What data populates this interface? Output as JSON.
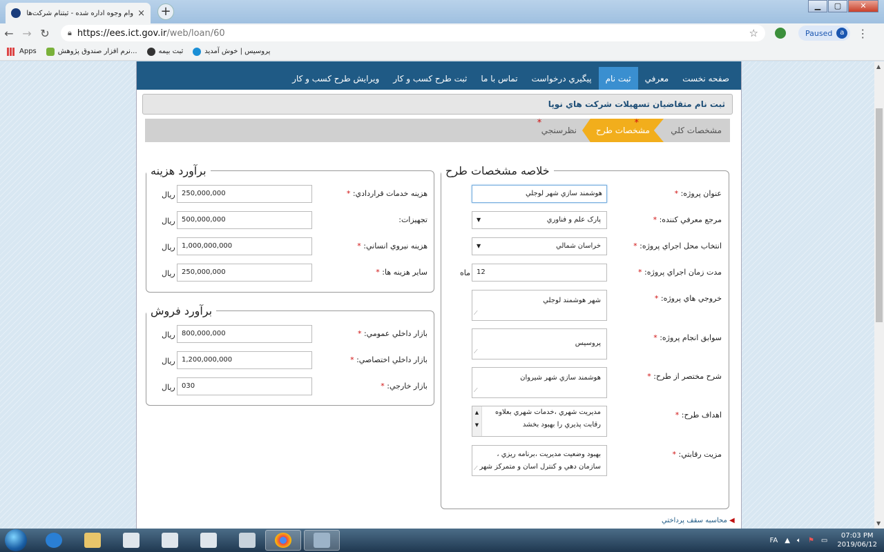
{
  "browser": {
    "tab_title": "وام وجوه اداره شده - ثبتنام شرکت‌های نوپا",
    "tab_close": "×",
    "new_tab": "+",
    "url_host": "https://ees.ict.gov.ir",
    "url_path": "/web/loan/60",
    "profile_status": "Paused",
    "profile_initial": "a",
    "bookmarks": [
      {
        "label": "Apps",
        "color": "#d44"
      },
      {
        "label": "نرم افزار صندوق پژوهش...",
        "color": "#7ab13a"
      },
      {
        "label": "ثبت بیمه",
        "color": "#333"
      },
      {
        "label": "پروسیس | خوش آمدید",
        "color": "#1a8fd6"
      }
    ]
  },
  "nav": {
    "items": [
      "صفحه نخست",
      "معرفي",
      "ثبت نام",
      "پيگيري درخواست",
      "تماس با ما",
      "ثبت طرح کسب و کار",
      "ويرايش طرح کسب و کار"
    ],
    "active_index": 2
  },
  "header": {
    "title": "ثبت نام متقاضيان تسهيلات شرکت هاي نوپا"
  },
  "steps": [
    {
      "label": "مشخصات کلي",
      "required": false
    },
    {
      "label": "مشخصات طرح",
      "required": true
    },
    {
      "label": "نظرسنجي",
      "required": true
    }
  ],
  "summary": {
    "legend": "خلاصه مشخصات طرح",
    "fields": {
      "title_label": "عنوان پروژه:",
      "title_value": "هوشمند سازي شهر لوجلي",
      "referrer_label": "مرجع معرفي کننده:",
      "referrer_value": "پارک علم و فناوري",
      "location_label": "انتخاب محل اجراي پروژه:",
      "location_value": "خراسان شمالي",
      "duration_label": "مدت زمان اجراي پروژه:",
      "duration_value": "12",
      "duration_unit": "ماه",
      "outputs_label": "خروجي هاي پروژه:",
      "outputs_value": "شهر هوشمند لوجلي",
      "history_label": "سوابق انجام پروژه:",
      "history_value": "پروسیس",
      "desc_label": "شرح مختصر از طرح:",
      "desc_value": "هوشمند سازي شهر شيروان",
      "goals_label": "اهداف طرح:",
      "goals_value": "مديريت شهري ،خدمات شهري بعلاوه رقابت پذيري را بهبود بخشد",
      "advantage_label": "مزيت رقابتي:",
      "advantage_value": "بهبود وضعيت مديريت ،برنامه ريزي ، سازمان دهي و کنترل اسان و متمرکز شهر",
      "required_mark": "*"
    }
  },
  "cost": {
    "legend": "برآورد هزينه",
    "unit": "ريال",
    "rows": [
      {
        "label": "هزينه خدمات قراردادي:",
        "value": "250,000,000",
        "required": true
      },
      {
        "label": "تجهيزات:",
        "value": "500,000,000",
        "required": false
      },
      {
        "label": "هزينه نيروي انساني:",
        "value": "1,000,000,000",
        "required": true
      },
      {
        "label": "ساير هزينه ها:",
        "value": "250,000,000",
        "required": true
      }
    ]
  },
  "sales": {
    "legend": "برآورد فروش",
    "unit": "ريال",
    "rows": [
      {
        "label": "بازار داخلي عمومي:",
        "value": "800,000,000",
        "required": true
      },
      {
        "label": "بازار داخلي اختصاصي:",
        "value": "1,200,000,000",
        "required": true
      },
      {
        "label": "بازار خارجي:",
        "value": "030",
        "required": true
      }
    ]
  },
  "footer_link": "محاسبه سقف پرداختي",
  "taskbar": {
    "lang": "FA",
    "time": "07:03 PM",
    "date": "2019/06/12"
  }
}
